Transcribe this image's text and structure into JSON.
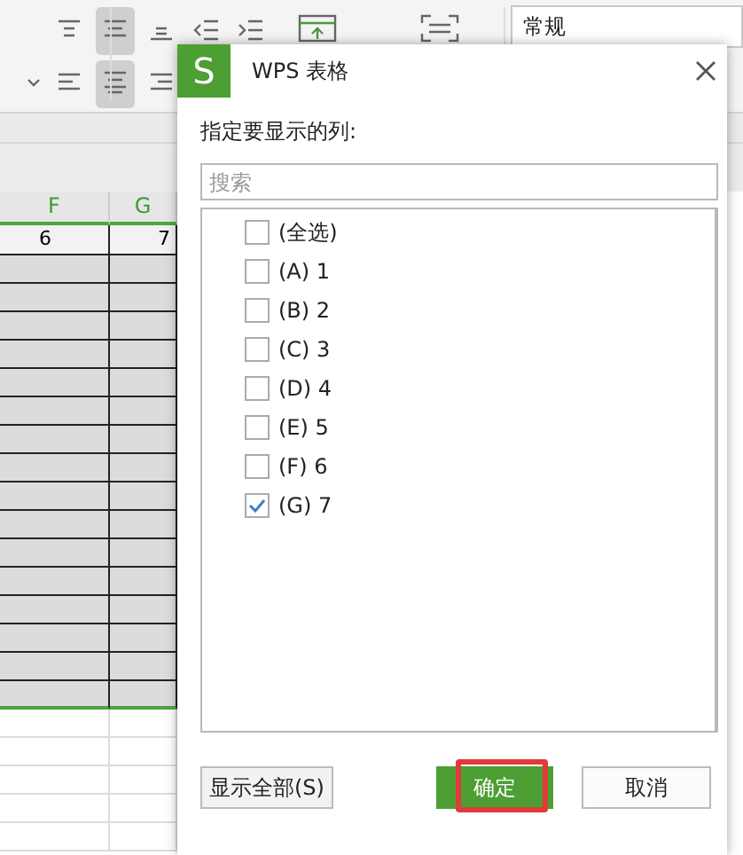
{
  "ribbon": {
    "number_format": "常规"
  },
  "sheet": {
    "columns": [
      {
        "label": "F",
        "selected": true
      },
      {
        "label": "G",
        "selected": true
      }
    ],
    "first_row": [
      "6",
      "7"
    ]
  },
  "dialog": {
    "logo": "S",
    "title": "WPS 表格",
    "prompt": "指定要显示的列:",
    "search": {
      "placeholder": "搜索"
    },
    "items": [
      {
        "label": "(全选)",
        "checked": false
      },
      {
        "label": "(A) 1",
        "checked": false
      },
      {
        "label": "(B) 2",
        "checked": false
      },
      {
        "label": "(C) 3",
        "checked": false
      },
      {
        "label": "(D) 4",
        "checked": false
      },
      {
        "label": "(E) 5",
        "checked": false
      },
      {
        "label": "(F) 6",
        "checked": false
      },
      {
        "label": "(G) 7",
        "checked": true
      }
    ],
    "buttons": [
      {
        "label": "显示全部(S)",
        "kind": "plain",
        "highlighted": false
      },
      {
        "label": "确定",
        "kind": "primary",
        "highlighted": true
      },
      {
        "label": "取消",
        "kind": "plain",
        "highlighted": false
      }
    ]
  }
}
